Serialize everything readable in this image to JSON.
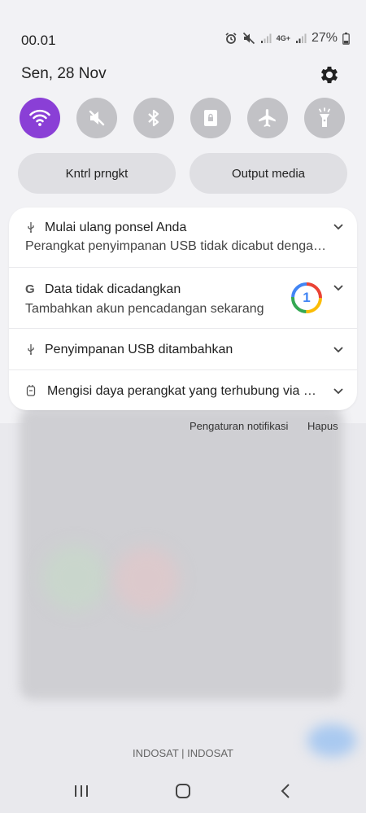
{
  "status_bar": {
    "time": "00.01",
    "network": "4G+",
    "battery": "27%"
  },
  "panel": {
    "date": "Sen, 28 Nov"
  },
  "quick_toggles": [
    {
      "icon": "wifi-icon",
      "active": true
    },
    {
      "icon": "sound-mute-icon",
      "active": false
    },
    {
      "icon": "bluetooth-icon",
      "active": false
    },
    {
      "icon": "portrait-lock-icon",
      "active": false
    },
    {
      "icon": "airplane-icon",
      "active": false
    },
    {
      "icon": "flashlight-icon",
      "active": false
    }
  ],
  "media_buttons": {
    "device_control": "Kntrl prngkt",
    "media_output": "Output media"
  },
  "notifications": [
    {
      "icon": "usb-icon",
      "title": "Mulai ulang ponsel Anda",
      "text": "Perangkat penyimpanan USB tidak dicabut dengan aman."
    },
    {
      "icon": "google-icon",
      "title": "Data tidak dicadangkan",
      "text": "Tambahkan akun pencadangan sekarang",
      "badge": "1"
    },
    {
      "icon": "usb-icon",
      "title": "Penyimpanan USB ditambahkan"
    },
    {
      "icon": "charging-icon",
      "title": "Mengisi daya perangkat yang terhubung via USB"
    }
  ],
  "notification_actions": {
    "settings": "Pengaturan notifikasi",
    "clear": "Hapus"
  },
  "carrier": "INDOSAT | INDOSAT",
  "colors": {
    "accent": "#8a3fd6",
    "toggle_inactive": "#c2c2c6",
    "card_bg": "#ffffff"
  }
}
